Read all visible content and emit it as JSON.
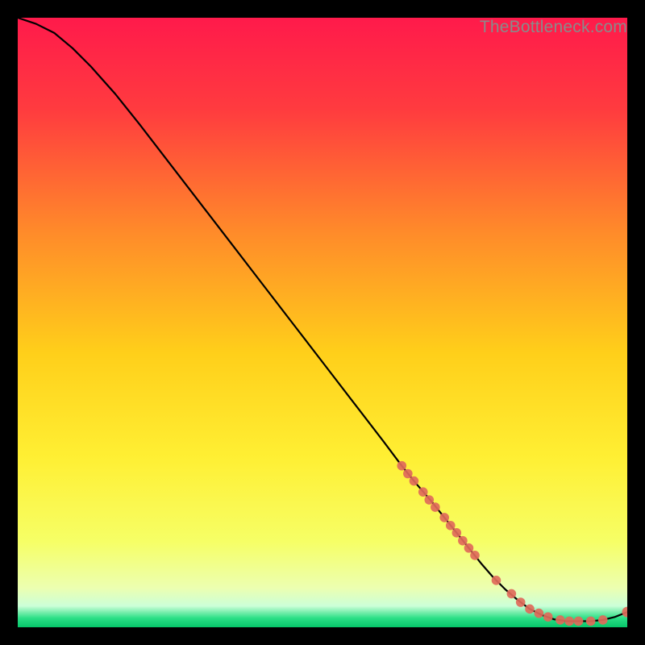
{
  "watermark": "TheBottleneck.com",
  "chart_data": {
    "type": "line",
    "title": "",
    "xlabel": "",
    "ylabel": "",
    "xlim": [
      0,
      100
    ],
    "ylim": [
      0,
      100
    ],
    "grid": false,
    "gradient_stops": [
      {
        "offset": 0.0,
        "color": "#ff1a4b"
      },
      {
        "offset": 0.15,
        "color": "#ff3b3f"
      },
      {
        "offset": 0.35,
        "color": "#ff8a2a"
      },
      {
        "offset": 0.55,
        "color": "#ffcf1a"
      },
      {
        "offset": 0.72,
        "color": "#ffef33"
      },
      {
        "offset": 0.86,
        "color": "#f6ff66"
      },
      {
        "offset": 0.935,
        "color": "#ecffb0"
      },
      {
        "offset": 0.965,
        "color": "#ccffd8"
      },
      {
        "offset": 0.985,
        "color": "#2bdf86"
      },
      {
        "offset": 1.0,
        "color": "#06c66a"
      }
    ],
    "series": [
      {
        "name": "bottleneck-curve",
        "type": "line",
        "x": [
          0,
          3,
          6,
          9,
          12,
          16,
          20,
          25,
          30,
          35,
          40,
          45,
          50,
          55,
          60,
          63,
          65,
          68,
          70,
          72,
          74,
          76,
          78,
          80,
          82,
          84,
          86,
          88,
          90,
          92,
          94,
          96,
          98,
          100
        ],
        "y": [
          100,
          99,
          97.5,
          95,
          92,
          87.5,
          82.5,
          76,
          69.5,
          63,
          56.5,
          50,
          43.5,
          37,
          30.5,
          26.5,
          24,
          20.5,
          18,
          15.5,
          13,
          10.5,
          8.2,
          6.2,
          4.5,
          3.0,
          2.0,
          1.3,
          1.0,
          1.0,
          1.0,
          1.2,
          1.7,
          2.5
        ]
      },
      {
        "name": "highlight-points",
        "type": "scatter",
        "x": [
          63,
          64,
          65,
          66.5,
          67.5,
          68.5,
          70,
          71,
          72,
          73,
          74,
          75,
          78.5,
          81,
          82.5,
          84,
          85.5,
          87,
          89,
          90.5,
          92,
          94,
          96,
          100
        ],
        "y": [
          26.5,
          25.2,
          24.0,
          22.2,
          20.9,
          19.7,
          18.0,
          16.7,
          15.5,
          14.2,
          13.0,
          11.8,
          7.7,
          5.5,
          4.1,
          3.0,
          2.3,
          1.7,
          1.2,
          1.0,
          1.0,
          1.0,
          1.2,
          2.5
        ]
      }
    ]
  }
}
